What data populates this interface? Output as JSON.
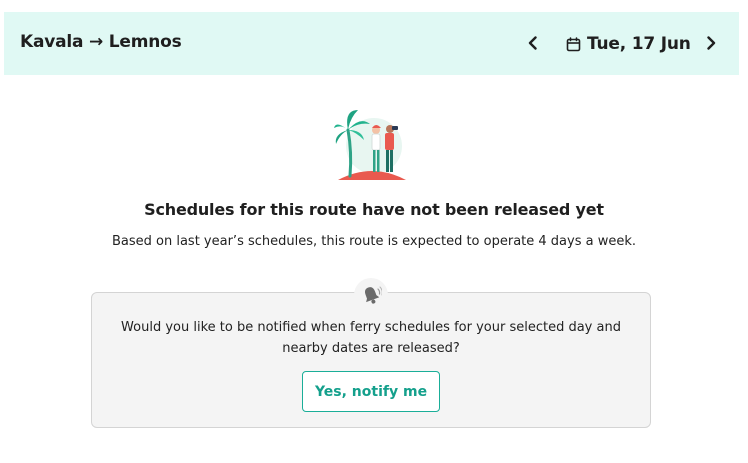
{
  "header": {
    "origin": "Kavala",
    "arrow": "→",
    "destination": "Lemnos",
    "date": "Tue, 17 Jun"
  },
  "message": {
    "title": "Schedules for this route have not been released yet",
    "subtitle": "Based on last year’s schedules, this route is expected to operate 4 days a week."
  },
  "notify": {
    "question": "Would you like to be notified when ferry schedules for your selected day and nearby dates are released?",
    "button_label": "Yes, notify me"
  },
  "icons": {
    "prev": "chevron-left-icon",
    "next": "chevron-right-icon",
    "calendar": "calendar-icon",
    "bell": "bell-icon",
    "illustration": "island-travelers-illustration"
  },
  "colors": {
    "header_bg": "#e0f9f4",
    "accent": "#1aae98",
    "card_bg": "#f4f4f4"
  }
}
